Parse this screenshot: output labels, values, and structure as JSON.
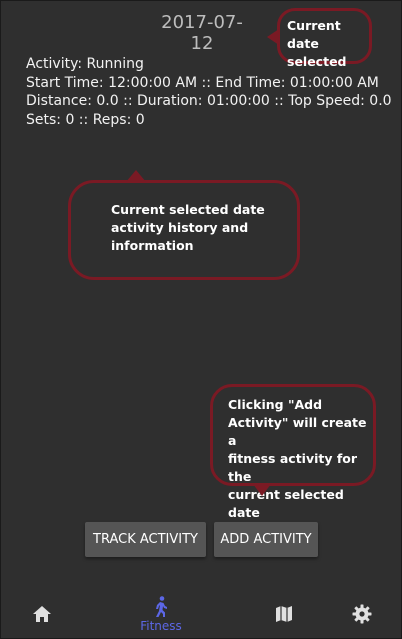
{
  "header": {
    "selected_date": "2017-07-12"
  },
  "activity": {
    "line1": "Activity: Running",
    "line2": "Start Time: 12:00:00 AM :: End Time: 01:00:00 AM",
    "line3": "Distance: 0.0 :: Duration: 01:00:00 :: Top Speed: 0.0",
    "line4": "Sets: 0 :: Reps: 0"
  },
  "callouts": {
    "date": [
      "Current date",
      "selected"
    ],
    "history": [
      "Current selected date",
      "activity history and",
      "information"
    ],
    "add": [
      "Clicking \"Add",
      "Activity\" will create a",
      "fitness activity for the",
      "current selected date"
    ]
  },
  "buttons": {
    "track": "TRACK ACTIVITY",
    "add": "ADD ACTIVITY"
  },
  "nav": {
    "items": [
      {
        "icon": "home-icon"
      },
      {
        "icon": "walking-person-icon",
        "label": "Fitness",
        "active": true
      },
      {
        "icon": "map-icon"
      },
      {
        "icon": "gear-icon"
      }
    ]
  },
  "colors": {
    "background": "#2f2f2f",
    "callout_border": "#7a1a24",
    "active_nav": "#5c67e6",
    "button": "#555555"
  }
}
